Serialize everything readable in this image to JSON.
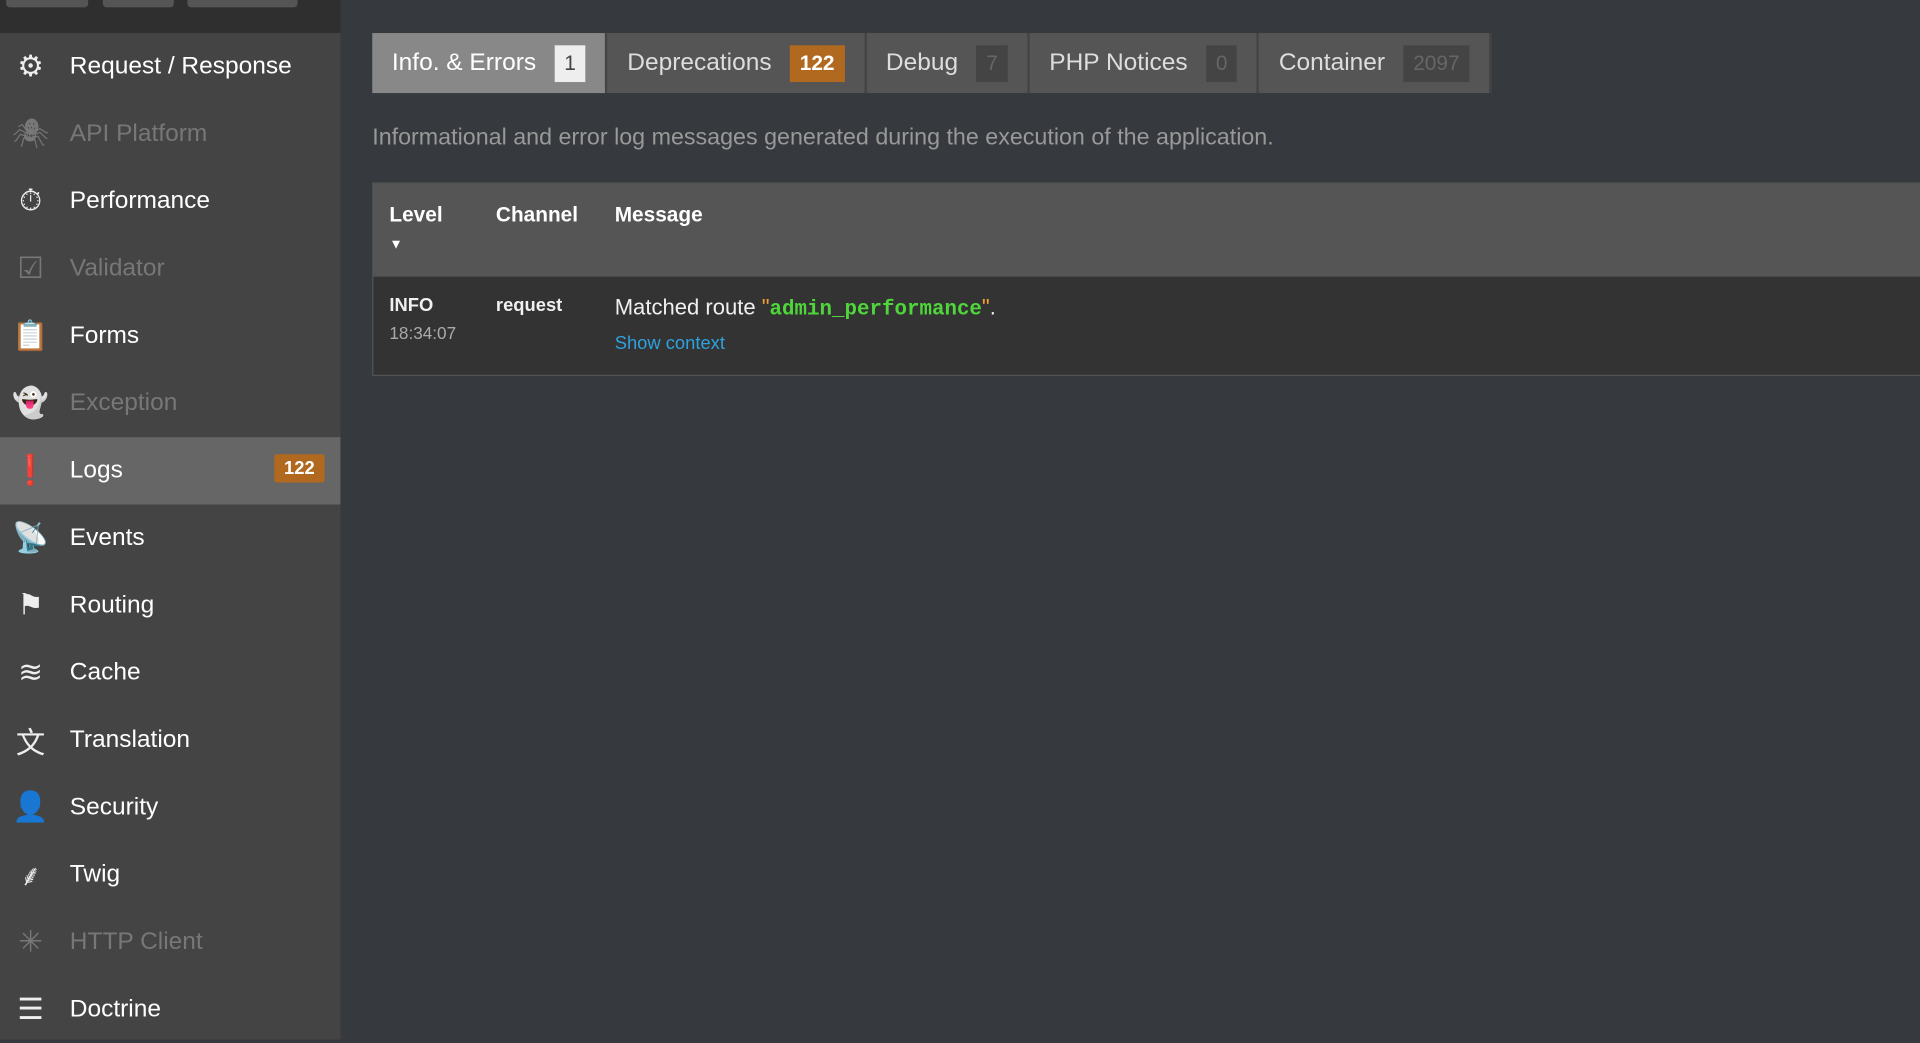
{
  "sidebar": {
    "items": [
      {
        "label": "Request / Response",
        "icon": "gears-icon",
        "enabled": true
      },
      {
        "label": "API Platform",
        "icon": "spider-icon",
        "enabled": false
      },
      {
        "label": "Performance",
        "icon": "stopwatch-icon",
        "enabled": true
      },
      {
        "label": "Validator",
        "icon": "checkbox-icon",
        "enabled": false
      },
      {
        "label": "Forms",
        "icon": "clipboard-icon",
        "enabled": true
      },
      {
        "label": "Exception",
        "icon": "ghost-icon",
        "enabled": false
      },
      {
        "label": "Logs",
        "icon": "alert-book-icon",
        "enabled": true,
        "selected": true,
        "badge": "122"
      },
      {
        "label": "Events",
        "icon": "antenna-icon",
        "enabled": true
      },
      {
        "label": "Routing",
        "icon": "signpost-icon",
        "enabled": true
      },
      {
        "label": "Cache",
        "icon": "layers-icon",
        "enabled": true
      },
      {
        "label": "Translation",
        "icon": "translate-icon",
        "enabled": true
      },
      {
        "label": "Security",
        "icon": "user-icon",
        "enabled": true
      },
      {
        "label": "Twig",
        "icon": "twig-icon",
        "enabled": true
      },
      {
        "label": "HTTP Client",
        "icon": "network-icon",
        "enabled": false
      },
      {
        "label": "Doctrine",
        "icon": "database-icon",
        "enabled": true
      }
    ]
  },
  "tabs": [
    {
      "label": "Info. & Errors",
      "count": "1",
      "active": true
    },
    {
      "label": "Deprecations",
      "count": "122"
    },
    {
      "label": "Debug",
      "count": "7"
    },
    {
      "label": "PHP Notices",
      "count": "0"
    },
    {
      "label": "Container",
      "count": "2097"
    }
  ],
  "description": "Informational and error log messages generated during the execution of the application.",
  "table": {
    "headers": {
      "level": "Level",
      "channel": "Channel",
      "message": "Message"
    },
    "rows": [
      {
        "level": "INFO",
        "time": "18:34:07",
        "channel": "request",
        "message_prefix": "Matched route ",
        "route": "admin_performance",
        "message_suffix": ".",
        "context_link": "Show context"
      }
    ]
  },
  "colors": {
    "badge_warning": "#b0691f",
    "route_green": "#4ed63a",
    "link": "#2ea2de"
  }
}
